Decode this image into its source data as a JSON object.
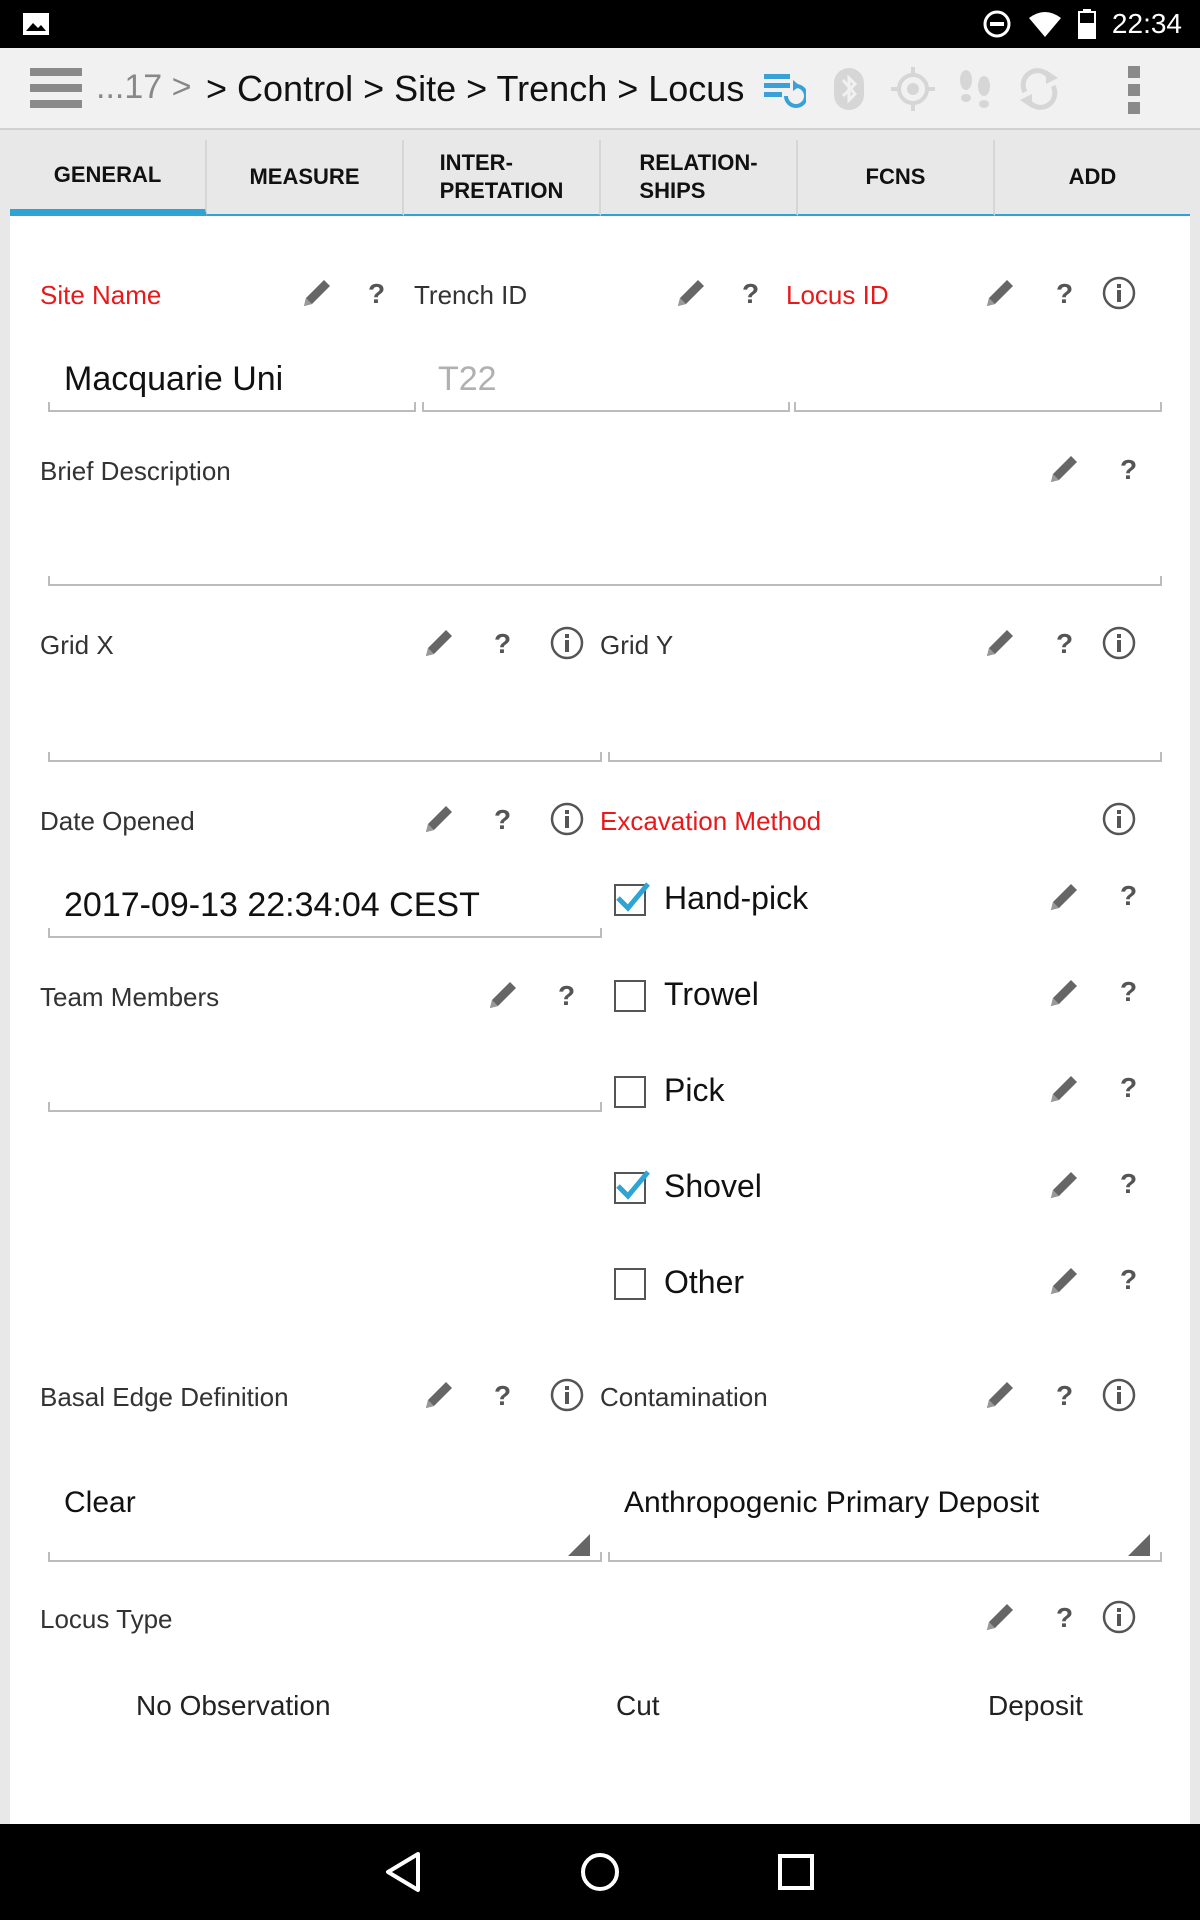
{
  "status_bar": {
    "time": "22:34",
    "icons": [
      "image-icon",
      "do-not-disturb-icon",
      "wifi-icon",
      "battery-icon"
    ]
  },
  "action_bar": {
    "crumb_prefix": "...17 >",
    "breadcrumb": "> Control > Site > Trench > Locus",
    "icons": [
      "menu-icon",
      "sync-icon",
      "bluetooth-icon",
      "gps-icon",
      "tracker-icon",
      "refresh-icon",
      "overflow-menu-icon"
    ]
  },
  "tabs": [
    {
      "line1": "GENERAL",
      "line2": "",
      "active": true
    },
    {
      "line1": "MEASURE",
      "line2": "",
      "active": false
    },
    {
      "line1": "INTER-",
      "line2": "PRETATION",
      "active": false
    },
    {
      "line1": "RELATION-",
      "line2": "SHIPS",
      "active": false
    },
    {
      "line1": "FCNS",
      "line2": "",
      "active": false
    },
    {
      "line1": "ADD",
      "line2": "",
      "active": false
    }
  ],
  "form": {
    "site_name": {
      "label": "Site Name",
      "value": "Macquarie Uni"
    },
    "trench_id": {
      "label": "Trench ID",
      "value": "T22"
    },
    "locus_id": {
      "label": "Locus ID",
      "value": ""
    },
    "brief_description": {
      "label": "Brief Description",
      "value": ""
    },
    "grid_x": {
      "label": "Grid X",
      "value": ""
    },
    "grid_y": {
      "label": "Grid Y",
      "value": ""
    },
    "date_opened": {
      "label": "Date Opened",
      "value": "2017-09-13 22:34:04 CEST"
    },
    "excavation_method": {
      "label": "Excavation Method",
      "options": [
        {
          "label": "Hand-pick",
          "checked": true
        },
        {
          "label": "Trowel",
          "checked": false
        },
        {
          "label": "Pick",
          "checked": false
        },
        {
          "label": "Shovel",
          "checked": true
        },
        {
          "label": "Other",
          "checked": false
        }
      ]
    },
    "team_members": {
      "label": "Team Members",
      "value": ""
    },
    "basal_edge_definition": {
      "label": "Basal Edge Definition",
      "value": "Clear"
    },
    "contamination": {
      "label": "Contamination",
      "value": "Anthropogenic Primary Deposit"
    },
    "locus_type": {
      "label": "Locus Type",
      "options": [
        "No Observation",
        "Cut",
        "Deposit"
      ]
    },
    "help_glyph": "?"
  },
  "colors": {
    "accent": "#2ea3d5",
    "required": "#e8191a",
    "check": "#2ea3d5"
  }
}
